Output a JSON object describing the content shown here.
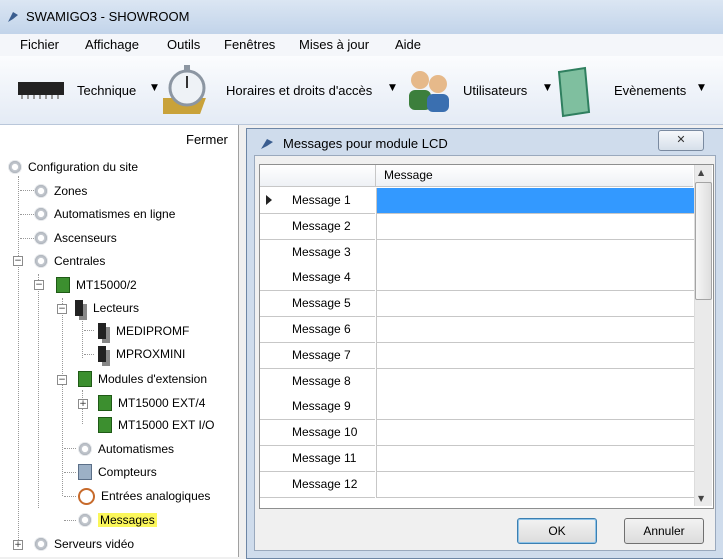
{
  "window": {
    "title": "SWAMIGO3 - SHOWROOM"
  },
  "menu": [
    "Fichier",
    "Affichage",
    "Outils",
    "Fenêtres",
    "Mises à jour",
    "Aide"
  ],
  "toolbar": {
    "technique": "Technique",
    "horaires": "Horaires et droits d'accès",
    "utilisateurs": "Utilisateurs",
    "evenements": "Evènements"
  },
  "tree": {
    "fermer": "Fermer",
    "items": [
      "Configuration du site",
      "Zones",
      "Automatismes en ligne",
      "Ascenseurs",
      "Centrales",
      "MT15000/2",
      "Lecteurs",
      "MEDIPROMF",
      "MPROXMINI",
      "Modules d'extension",
      "MT15000 EXT/4",
      "MT15000 EXT I/O",
      "Automatismes",
      "Compteurs",
      "Entrées analogiques",
      "Messages",
      "Serveurs vidéo"
    ]
  },
  "dialog": {
    "title": "Messages pour module LCD",
    "column_header": "Message",
    "rows": [
      "Message 1",
      "Message 2",
      "Message 3",
      "Message 4",
      "Message 5",
      "Message 6",
      "Message 7",
      "Message 8",
      "Message 9",
      "Message 10",
      "Message 11",
      "Message 12"
    ],
    "selected_row": 0,
    "ok_label": "OK",
    "cancel_label": "Annuler"
  },
  "colors": {
    "selection": "#3399ff",
    "highlight": "#fbf75b",
    "titlebar": "#c2d4ea"
  }
}
